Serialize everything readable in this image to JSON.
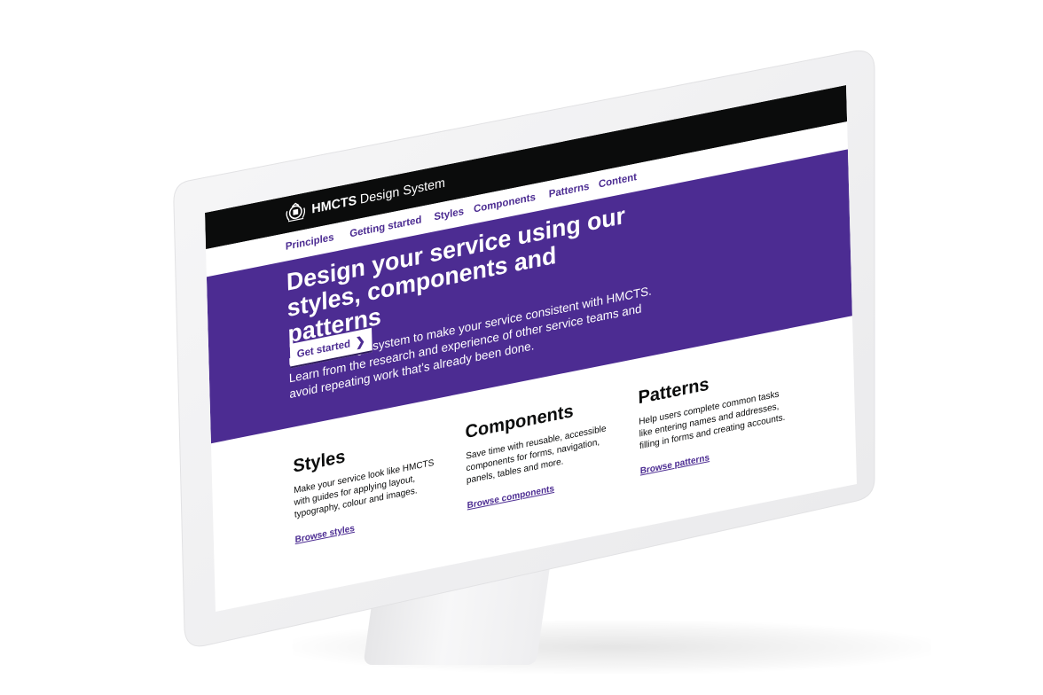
{
  "header": {
    "logo_bold": "HMCTS",
    "logo_rest": "Design System"
  },
  "nav": {
    "items": [
      {
        "label": "Principles"
      },
      {
        "label": "Getting started"
      },
      {
        "label": "Styles"
      },
      {
        "label": "Components"
      },
      {
        "label": "Patterns"
      },
      {
        "label": "Content"
      }
    ]
  },
  "hero": {
    "title": "Design your service using our styles, components and patterns",
    "text": "Use this design system to make your service consistent with HMCTS. Learn from the research and experience of other service teams and avoid repeating work that’s already been done.",
    "button_label": "Get started",
    "button_icon": "chevron-right-icon"
  },
  "cards": [
    {
      "title": "Styles",
      "text": "Make your service look like HMCTS with guides for applying layout, typography, colour and images.",
      "link": "Browse styles"
    },
    {
      "title": "Components",
      "text": "Save time with reusable, accessible components for forms, navigation, panels, tables and more.",
      "link": "Browse components"
    },
    {
      "title": "Patterns",
      "text": "Help users complete common tasks like entering names and addresses, filling in forms and creating accounts.",
      "link": "Browse patterns"
    }
  ],
  "colors": {
    "brand_purple": "#4c2c92",
    "header_black": "#0b0c0c",
    "bezel": "#f2f2f3"
  }
}
